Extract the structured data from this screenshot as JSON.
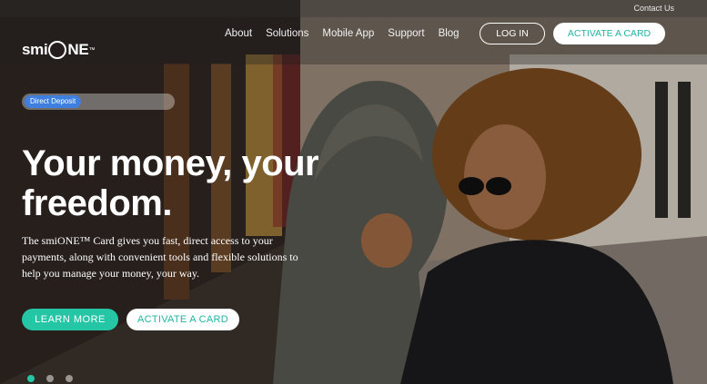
{
  "topbar": {
    "contact_label": "Contact Us"
  },
  "brand": {
    "name": "smiONE"
  },
  "nav": {
    "items": [
      {
        "label": "About"
      },
      {
        "label": "Solutions"
      },
      {
        "label": "Mobile App"
      },
      {
        "label": "Support"
      },
      {
        "label": "Blog"
      }
    ]
  },
  "header": {
    "login_label": "LOG IN",
    "activate_label": "ACTIVATE A CARD"
  },
  "hero": {
    "tag": "Direct Deposit",
    "headline": "Your money, your freedom.",
    "subtext": "The smiONE™ Card gives you fast, direct access to your payments, along with convenient tools and flexible solutions to help you manage your money, your way.",
    "learn_more_label": "LEARN MORE",
    "activate_label": "ACTIVATE A CARD"
  },
  "carousel": {
    "slides": 3,
    "active_index": 0
  },
  "colors": {
    "accent": "#25c6a6",
    "tag_blue": "#3e7fe0"
  },
  "icons": {
    "logo": "smione-logo-mark"
  }
}
